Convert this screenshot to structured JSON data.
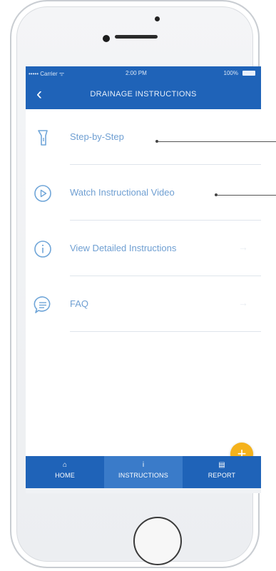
{
  "status_bar": {
    "carrier": "••••• Carrier ᯤ",
    "time": "2:00 PM",
    "battery": "100%"
  },
  "nav": {
    "back_icon": "chevron-left-icon",
    "title": "DRAINAGE INSTRUCTIONS"
  },
  "items": [
    {
      "label": "Step-by-Step",
      "icon": "flashlight-icon",
      "arrow": ""
    },
    {
      "label": "Watch Instructional Video",
      "icon": "play-circle-icon",
      "arrow": ""
    },
    {
      "label": "View Detailed Instructions",
      "icon": "info-circle-icon",
      "arrow": "→"
    },
    {
      "label": "FAQ",
      "icon": "chat-bubble-icon",
      "arrow": "→"
    }
  ],
  "fab": {
    "label": "+",
    "icon": "plus-icon"
  },
  "tabs": [
    {
      "label": "HOME",
      "icon": "house-icon",
      "glyph": "⌂",
      "active": false
    },
    {
      "label": "INSTRUCTIONS",
      "icon": "info-icon",
      "glyph": "i",
      "active": true
    },
    {
      "label": "REPORT",
      "icon": "document-icon",
      "glyph": "▤",
      "active": false
    }
  ],
  "colors": {
    "primary": "#1f63b8",
    "active_tab": "#3a7bc9",
    "list_text": "#6f9fd2",
    "fab": "#f5b21b"
  }
}
